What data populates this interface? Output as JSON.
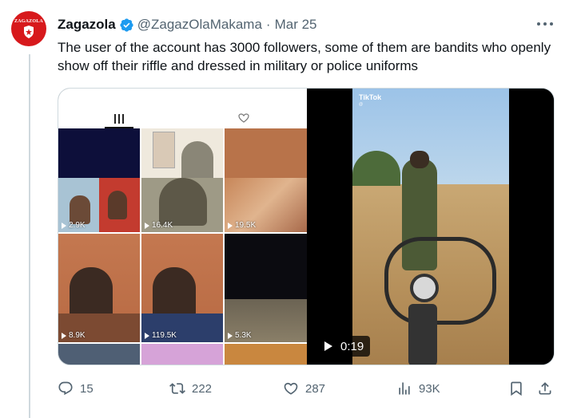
{
  "tweet": {
    "author_name": "Zagazola",
    "handle": "@ZagazOlaMakama",
    "separator": "·",
    "date": "Mar 25",
    "avatar_text": "ZAGAZOLA",
    "text": "The user of the account has 3000 followers, some of them are bandits who openly show off their riffle and dressed in military or police uniforms"
  },
  "media": {
    "grid_tiles": [
      {
        "views": ""
      },
      {
        "views": ""
      },
      {
        "views": ""
      },
      {
        "views": "2.9K"
      },
      {
        "views": "16.4K"
      },
      {
        "views": "19.5K"
      },
      {
        "views": "8.9K"
      },
      {
        "views": "119.5K"
      },
      {
        "views": "5.3K"
      }
    ],
    "video": {
      "watermark": "TikTok",
      "watermark_sub": "@",
      "duration": "0:19"
    }
  },
  "actions": {
    "replies": "15",
    "retweets": "222",
    "likes": "287",
    "views": "93K"
  },
  "colors": {
    "verified": "#1d9bf0",
    "text_primary": "#0f1419",
    "text_secondary": "#536471",
    "avatar_bg": "#d7191c"
  }
}
